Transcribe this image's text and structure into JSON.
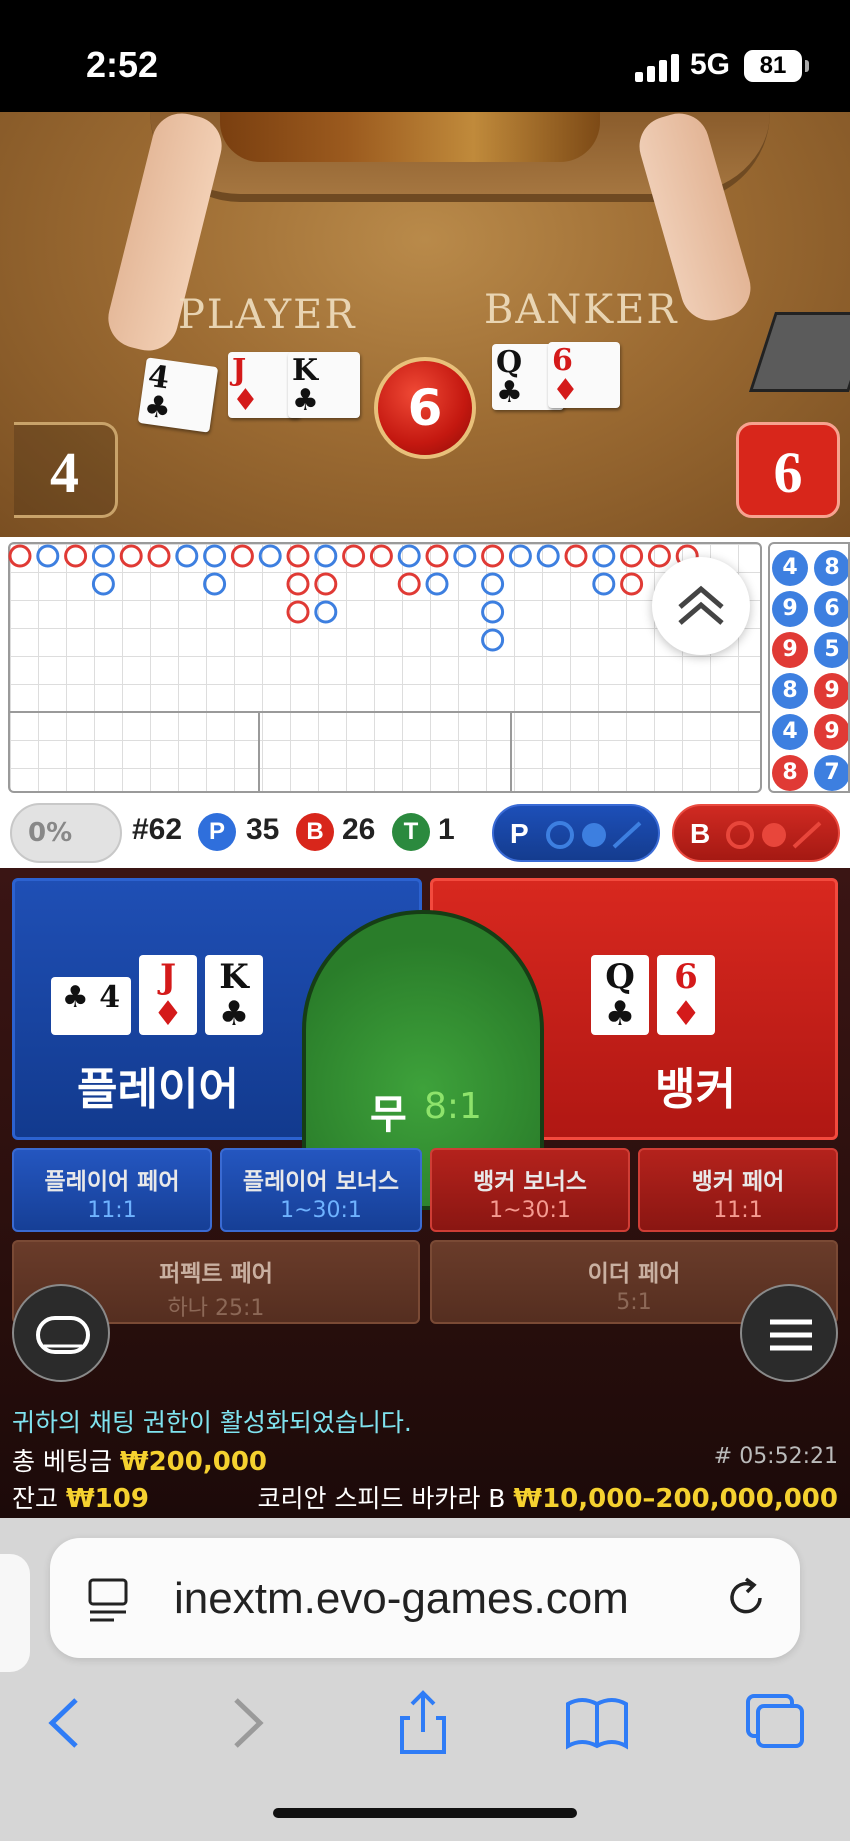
{
  "status_bar": {
    "time": "2:52",
    "network": "5G",
    "battery": "81"
  },
  "video": {
    "player_label": "PLAYER",
    "banker_label": "BANKER",
    "result_ball": "6",
    "player_score": "4",
    "banker_score": "6",
    "player_cards": [
      {
        "rank": "4",
        "suit": "♣",
        "color": "black"
      },
      {
        "rank": "J",
        "suit": "♦",
        "color": "red"
      },
      {
        "rank": "K",
        "suit": "♣",
        "color": "black"
      }
    ],
    "banker_cards": [
      {
        "rank": "Q",
        "suit": "♣",
        "color": "black"
      },
      {
        "rank": "6",
        "suit": "♦",
        "color": "red"
      }
    ]
  },
  "roadmap": {
    "bead_column": [
      {
        "a": "4",
        "b": "8",
        "colors": [
          "#3d7fe0",
          "#3d7fe0"
        ]
      },
      {
        "a": "9",
        "b": "6",
        "colors": [
          "#3d7fe0",
          "#3d7fe0"
        ]
      },
      {
        "a": "9",
        "b": "5",
        "colors": [
          "#e03a35",
          "#3d7fe0"
        ]
      },
      {
        "a": "8",
        "b": "9",
        "colors": [
          "#3d7fe0",
          "#e03a35"
        ]
      },
      {
        "a": "4",
        "b": "9",
        "colors": [
          "#3d7fe0",
          "#e03a35"
        ]
      },
      {
        "a": "8",
        "b": "7",
        "colors": [
          "#e03a35",
          "#3d7fe0"
        ]
      }
    ]
  },
  "stats": {
    "percent": "0%",
    "round": "#62",
    "p_letter": "P",
    "p_count": "35",
    "b_letter": "B",
    "b_count": "26",
    "t_letter": "T",
    "t_count": "1",
    "predict_p": "P",
    "predict_b": "B"
  },
  "bets": {
    "player_label": "플레이어",
    "tie_label": "무",
    "tie_odds": "8:1",
    "banker_label": "뱅커",
    "player_cards": [
      {
        "rank": "4",
        "suit": "♣",
        "color": "black"
      },
      {
        "rank": "J",
        "suit": "♦",
        "color": "red"
      },
      {
        "rank": "K",
        "suit": "♣",
        "color": "black"
      }
    ],
    "banker_cards": [
      {
        "rank": "Q",
        "suit": "♣",
        "color": "black"
      },
      {
        "rank": "6",
        "suit": "♦",
        "color": "red"
      }
    ],
    "side_bets": [
      {
        "title": "플레이어 페어",
        "odds": "11:1"
      },
      {
        "title": "플레이어 보너스",
        "odds": "1~30:1"
      },
      {
        "title": "뱅커 보너스",
        "odds": "1~30:1"
      },
      {
        "title": "뱅커 페어",
        "odds": "11:1"
      },
      {
        "title": "퍼펙트 페어",
        "odds": "하나 25:1"
      },
      {
        "title": "이더 페어",
        "odds": "5:1"
      }
    ]
  },
  "footer_info": {
    "chat_message": "귀하의 채팅 권한이 활성화되었습니다.",
    "total_bet_label": "총 베팅금",
    "total_bet_value": "₩200,000",
    "timestamp": "# 05:52:21",
    "balance_label": "잔고",
    "balance_value": "₩109",
    "table_name": "코리안 스피드 바카라 B",
    "limits": "₩10,000–200,000,000"
  },
  "browser": {
    "url": "inextm.evo-games.com"
  },
  "colors": {
    "player_blue": "#1f4fb5",
    "banker_red": "#d8281f",
    "tie_green": "#2a7d2a",
    "accent_yellow": "#f5d12f"
  }
}
